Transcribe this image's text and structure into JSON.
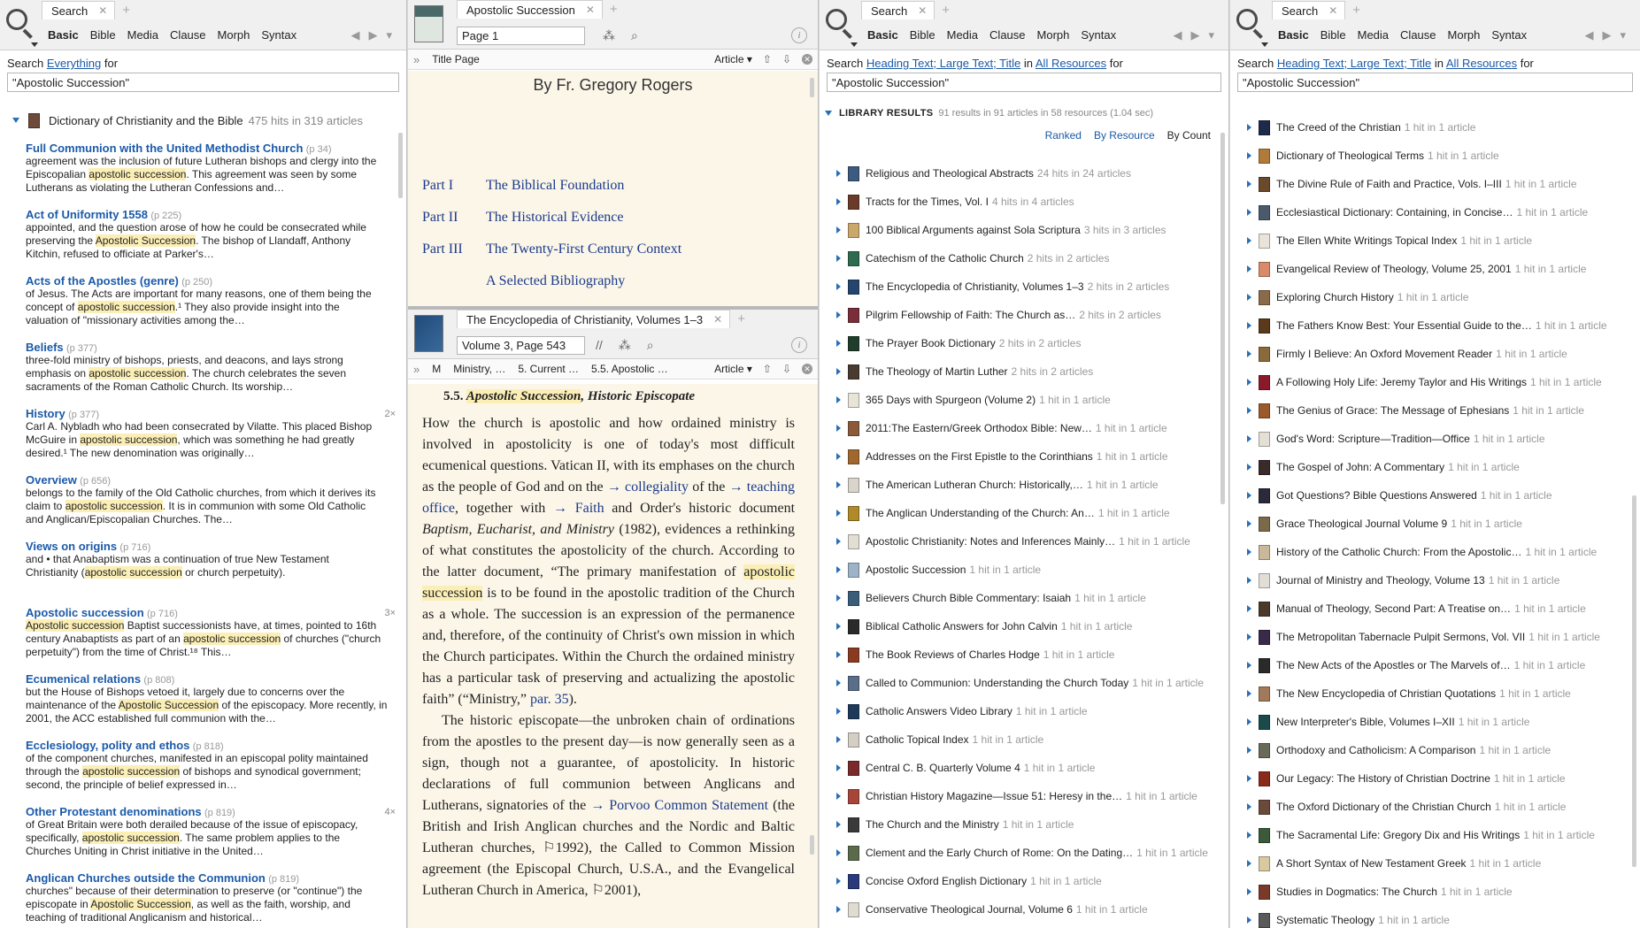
{
  "p1": {
    "tab": "Search",
    "types": [
      "Basic",
      "Bible",
      "Media",
      "Clause",
      "Morph",
      "Syntax"
    ],
    "searchfor": {
      "pre": "Search",
      "scope": "Everything",
      "post": "for"
    },
    "query": "\"Apostolic Succession\"",
    "group": {
      "title": "Dictionary of Christianity and the Bible",
      "hits": "475 hits in 319 articles"
    },
    "results": [
      {
        "title": "Full Communion with the United Methodist Church",
        "page": "(p 34)",
        "count": "",
        "text": [
          "agreement was the inclusion of future Lutheran bishops and clergy into the",
          "Episcopalian |apostolic succession|. This agreement was seen by some",
          "Lutherans as violating the Lutheran Confessions and…"
        ]
      },
      {
        "title": "Act of Uniformity 1558",
        "page": "(p 225)",
        "count": "",
        "text": [
          "appointed, and the question arose of how he could be consecrated while",
          "preserving the |Apostolic Succession|. The bishop of Llandaff, Anthony",
          "Kitchin, refused to officiate at Parker's…"
        ]
      },
      {
        "title": "Acts of the Apostles (genre)",
        "page": "(p 250)",
        "count": "",
        "text": [
          "of Jesus. The Acts are important for many reasons, one of them being the",
          "concept of |apostolic succession|.¹ They also provide insight into the",
          "valuation of \"missionary activities among the…"
        ]
      },
      {
        "title": "Beliefs",
        "page": "(p 377)",
        "count": "",
        "text": [
          "three-fold ministry of bishops, priests, and deacons, and lays strong",
          "emphasis on |apostolic succession|. The church celebrates the seven",
          "sacraments of the Roman Catholic Church. Its worship…"
        ]
      },
      {
        "title": "History",
        "page": "(p 377)",
        "count": "2×",
        "text": [
          "Carl A. Nybladh who had been consecrated by Vilatte. This placed Bishop",
          "McGuire in |apostolic succession|, which was something he had greatly",
          "desired.¹ The new denomination was originally…"
        ]
      },
      {
        "title": "Overview",
        "page": "(p 656)",
        "count": "",
        "text": [
          "belongs to the family of the Old Catholic churches, from which it derives its",
          "claim to |apostolic succession|. It is in communion with some Old Catholic",
          "and Anglican/Episcopalian Churches. The…"
        ]
      },
      {
        "title": "Views on origins",
        "page": "(p 716)",
        "count": "",
        "text": [
          "and • that Anabaptism was a continuation of true New Testament",
          "Christianity (|apostolic succession| or church perpetuity).",
          ""
        ]
      },
      {
        "title": "Apostolic succession",
        "page": "(p 716)",
        "count": "3×",
        "text": [
          "|Apostolic succession| Baptist successionists have, at times, pointed to 16th",
          "century Anabaptists as part of an |apostolic succession| of churches (\"church",
          "perpetuity\") from the time of Christ.¹⁸ This…"
        ]
      },
      {
        "title": "Ecumenical relations",
        "page": "(p 808)",
        "count": "",
        "text": [
          "but the House of Bishops vetoed it, largely due to concerns over the",
          "maintenance of the |Apostolic Succession| of the episcopacy. More recently, in",
          "2001, the ACC established full communion with the…"
        ]
      },
      {
        "title": "Ecclesiology, polity and ethos",
        "page": "(p 818)",
        "count": "",
        "text": [
          "of the component churches, manifested in an episcopal polity maintained",
          "through the |apostolic succession| of bishops and synodical government;",
          "second, the principle of belief expressed in…"
        ]
      },
      {
        "title": "Other Protestant denominations",
        "page": "(p 819)",
        "count": "4×",
        "text": [
          "of Great Britain were both derailed because of the issue of episcopacy,",
          "specifically, |apostolic succession|. The same problem applies to the",
          "Churches Uniting in Christ initiative in the United…"
        ]
      },
      {
        "title": "Anglican Churches outside the Communion",
        "page": "(p 819)",
        "count": "",
        "text": [
          "churches\" because of their determination to preserve (or \"continue\") the",
          "episcopate in |Apostolic Succession|, as well as the faith, worship, and",
          "teaching of traditional Anglicanism and historical…"
        ]
      }
    ]
  },
  "p2": {
    "tab": "Apostolic Succession",
    "page": "Page 1",
    "bar": "Title Page",
    "article": "Article",
    "author": "By Fr. Gregory Rogers",
    "toc": [
      {
        "part": "Part I",
        "title": "The Biblical Foundation"
      },
      {
        "part": "Part II",
        "title": "The Historical Evidence"
      },
      {
        "part": "Part III",
        "title": "The Twenty-First Century Context"
      },
      {
        "part": "",
        "title": "A Selected Bibliography"
      }
    ]
  },
  "p2b": {
    "tab": "The Encyclopedia of Christianity, Volumes 1–3",
    "page": "Volume 3, Page 543",
    "crumbs": [
      "M",
      "Ministry, …",
      "5. Current …",
      "5.5. Apostolic …"
    ],
    "article": "Article",
    "heading_num": "5.5.",
    "heading_hl": "Apostolic Succession",
    "heading_rest": ", Historic Episcopate",
    "para1": [
      {
        "t": "How the church is apostolic and how ordained ministry is involved in apostolicity is one of today's most difficult ecumenical questions. Vatican II, with its emphases on the church as the people of God and on the "
      },
      {
        "t": "→ collegiality",
        "ref": true
      },
      {
        "t": " of the "
      },
      {
        "t": "→ teaching office",
        "ref": true
      },
      {
        "t": ", together with "
      },
      {
        "t": "→ Faith",
        "ref": true
      },
      {
        "t": " and Order's historic document "
      },
      {
        "t": "Baptism, Eucharist, and Ministry",
        "i": true
      },
      {
        "t": " (1982), evidences a rethinking of what constitutes the apostolicity of the church. According to the latter document, “The primary manifestation of "
      },
      {
        "t": "apostolic succession",
        "hl": true
      },
      {
        "t": " is to be found in the apostolic tradition of the Church as a whole. The succession is an expression of the permanence and, therefore, of the continuity of Christ's own mission in which the Church participates. Within the Church the ordained ministry has a particular task of preserving and actualizing the apostolic faith” (“Ministry,” "
      },
      {
        "t": "par. 35",
        "ref": true
      },
      {
        "t": ")."
      }
    ],
    "para2": [
      {
        "t": "The historic episcopate—the unbroken chain of ordinations from the apostles to the present day—is now generally seen as a sign, though not a guarantee, of apostolicity. In historic declarations of full communion between Anglicans and Lutherans, signatories of the "
      },
      {
        "t": "→ Porvoo Common Statement",
        "ref": true
      },
      {
        "t": " (the British and Irish Anglican churches and the Nordic and Baltic Lutheran churches, ⚐1992), the Called to Common Mission agreement (the Episcopal Church, U.S.A., and the Evangelical Lutheran Church in America, ⚐2001),"
      }
    ]
  },
  "p3": {
    "tab": "Search",
    "types": [
      "Basic",
      "Bible",
      "Media",
      "Clause",
      "Morph",
      "Syntax"
    ],
    "searchfor": {
      "pre": "Search",
      "scope": "Heading Text; Large Text; Title",
      "mid": "in",
      "res": "All Resources",
      "post": "for"
    },
    "query": "\"Apostolic Succession\"",
    "lib": {
      "label": "LIBRARY RESULTS",
      "summary": "91 results in 91 articles in 58 resources (1.04 sec)"
    },
    "sort": [
      "Ranked",
      "By Resource",
      "By Count"
    ],
    "items": [
      {
        "t": "Religious and Theological Abstracts",
        "c": "24 hits in 24 articles",
        "col": "#3d5a80"
      },
      {
        "t": "Tracts for the Times, Vol. I",
        "c": "4 hits in 4 articles",
        "col": "#6b3b2a"
      },
      {
        "t": "100 Biblical Arguments against Sola Scriptura",
        "c": "3 hits in 3 articles",
        "col": "#c9a86a"
      },
      {
        "t": "Catechism of the Catholic Church",
        "c": "2 hits in 2 articles",
        "col": "#2e6b4f"
      },
      {
        "t": "The Encyclopedia of Christianity, Volumes 1–3",
        "c": "2 hits in 2 articles",
        "col": "#24466e"
      },
      {
        "t": "Pilgrim Fellowship of Faith: The Church as…",
        "c": "2 hits in 2 articles",
        "col": "#7a2e3a"
      },
      {
        "t": "The Prayer Book Dictionary",
        "c": "2 hits in 2 articles",
        "col": "#1f3d2a"
      },
      {
        "t": "The Theology of Martin Luther",
        "c": "2 hits in 2 articles",
        "col": "#4a3b30"
      },
      {
        "t": "365 Days with Spurgeon (Volume 2)",
        "c": "1 hit in 1 article",
        "col": "#e9e4d8"
      },
      {
        "t": "2011:The Eastern/Greek Orthodox Bible: New…",
        "c": "1 hit in 1 article",
        "col": "#8a5a3a"
      },
      {
        "t": "Addresses on the First Epistle to the Corinthians",
        "c": "1 hit in 1 article",
        "col": "#a0672f"
      },
      {
        "t": "The American Lutheran Church: Historically,…",
        "c": "1 hit in 1 article",
        "col": "#d9d5cc"
      },
      {
        "t": "The Anglican Understanding of the Church: An…",
        "c": "1 hit in 1 article",
        "col": "#b08a2a"
      },
      {
        "t": "Apostolic Christianity: Notes and Inferences Mainly…",
        "c": "1 hit in 1 article",
        "col": "#e2ded4"
      },
      {
        "t": "Apostolic Succession",
        "c": "1 hit in 1 article",
        "col": "#9fb3c8"
      },
      {
        "t": "Believers Church Bible Commentary: Isaiah",
        "c": "1 hit in 1 article",
        "col": "#3a5e7a"
      },
      {
        "t": "Biblical Catholic Answers for John Calvin",
        "c": "1 hit in 1 article",
        "col": "#2a2a2a"
      },
      {
        "t": "The Book Reviews of Charles Hodge",
        "c": "1 hit in 1 article",
        "col": "#8a3a20"
      },
      {
        "t": "Called to Communion: Understanding the Church Today",
        "c": "1 hit in 1 article",
        "col": "#5a6e8a"
      },
      {
        "t": "Catholic Answers Video Library",
        "c": "1 hit in 1 article",
        "col": "#1d3a5a"
      },
      {
        "t": "Catholic Topical Index",
        "c": "1 hit in 1 article",
        "col": "#d4cfc4"
      },
      {
        "t": "Central C. B. Quarterly Volume 4",
        "c": "1 hit in 1 article",
        "col": "#7a2a2a"
      },
      {
        "t": "Christian History Magazine—Issue 51: Heresy in the…",
        "c": "1 hit in 1 article",
        "col": "#a8453a"
      },
      {
        "t": "The Church and the Ministry",
        "c": "1 hit in 1 article",
        "col": "#3a3a3a"
      },
      {
        "t": "Clement and the Early Church of Rome: On the Dating…",
        "c": "1 hit in 1 article",
        "col": "#5a6a4a"
      },
      {
        "t": "Concise Oxford English Dictionary",
        "c": "1 hit in 1 article",
        "col": "#2a3a7a"
      },
      {
        "t": "Conservative Theological Journal, Volume 6",
        "c": "1 hit in 1 article",
        "col": "#e0dcd2"
      }
    ]
  },
  "p4": {
    "tab": "Search",
    "types": [
      "Basic",
      "Bible",
      "Media",
      "Clause",
      "Morph",
      "Syntax"
    ],
    "searchfor": {
      "pre": "Search",
      "scope": "Heading Text; Large Text; Title",
      "mid": "in",
      "res": "All Resources",
      "post": "for"
    },
    "query": "\"Apostolic Succession\"",
    "items": [
      {
        "t": "The Creed of the Christian",
        "c": "1 hit in 1 article",
        "col": "#1d2a4a"
      },
      {
        "t": "Dictionary of Theological Terms",
        "c": "1 hit in 1 article",
        "col": "#b07a3a"
      },
      {
        "t": "The Divine Rule of Faith and Practice, Vols. I–III",
        "c": "1 hit in 1 article",
        "col": "#6a4a2a"
      },
      {
        "t": "Ecclesiastical Dictionary: Containing, in Concise…",
        "c": "1 hit in 1 article",
        "col": "#4a5a6a"
      },
      {
        "t": "The Ellen White Writings Topical Index",
        "c": "1 hit in 1 article",
        "col": "#e8e4da"
      },
      {
        "t": "Evangelical Review of Theology, Volume 25, 2001",
        "c": "1 hit in 1 article",
        "col": "#d98a6a"
      },
      {
        "t": "Exploring Church History",
        "c": "1 hit in 1 article",
        "col": "#8a6a4a"
      },
      {
        "t": "The Fathers Know Best: Your Essential Guide to the…",
        "c": "1 hit in 1 article",
        "col": "#5a3a1a"
      },
      {
        "t": "Firmly I Believe: An Oxford Movement Reader",
        "c": "1 hit in 1 article",
        "col": "#8a6a3a"
      },
      {
        "t": "A Following Holy Life: Jeremy Taylor and His Writings",
        "c": "1 hit in 1 article",
        "col": "#8a1a2a"
      },
      {
        "t": "The Genius of Grace: The Message of Ephesians",
        "c": "1 hit in 1 article",
        "col": "#9a5a2a"
      },
      {
        "t": "God's Word: Scripture—Tradition—Office",
        "c": "1 hit in 1 article",
        "col": "#e4e0d6"
      },
      {
        "t": "The Gospel of John: A Commentary",
        "c": "1 hit in 1 article",
        "col": "#3a2a2a"
      },
      {
        "t": "Got Questions? Bible Questions Answered",
        "c": "1 hit in 1 article",
        "col": "#2a2a3a"
      },
      {
        "t": "Grace Theological Journal Volume 9",
        "c": "1 hit in 1 article",
        "col": "#7a6a4a"
      },
      {
        "t": "History of the Catholic Church: From the Apostolic…",
        "c": "1 hit in 1 article",
        "col": "#c9b89a"
      },
      {
        "t": "Journal of Ministry and Theology, Volume 13",
        "c": "1 hit in 1 article",
        "col": "#e2ded6"
      },
      {
        "t": "Manual of Theology, Second Part: A Treatise on…",
        "c": "1 hit in 1 article",
        "col": "#4a3a2a"
      },
      {
        "t": "The Metropolitan Tabernacle Pulpit Sermons, Vol. VII",
        "c": "1 hit in 1 article",
        "col": "#3a2a4a"
      },
      {
        "t": "The New Acts of the Apostles or The Marvels of…",
        "c": "1 hit in 1 article",
        "col": "#2a2a2a"
      },
      {
        "t": "The New Encyclopedia of Christian Quotations",
        "c": "1 hit in 1 article",
        "col": "#a07a5a"
      },
      {
        "t": "New Interpreter's Bible, Volumes I–XII",
        "c": "1 hit in 1 article",
        "col": "#1a4a4a"
      },
      {
        "t": "Orthodoxy and Catholicism: A Comparison",
        "c": "1 hit in 1 article",
        "col": "#6a6a5a"
      },
      {
        "t": "Our Legacy: The History of Christian Doctrine",
        "c": "1 hit in 1 article",
        "col": "#8a2a1a"
      },
      {
        "t": "The Oxford Dictionary of the Christian Church",
        "c": "1 hit in 1 article",
        "col": "#6a4a3a"
      },
      {
        "t": "The Sacramental Life: Gregory Dix and His Writings",
        "c": "1 hit in 1 article",
        "col": "#3a5a3a"
      },
      {
        "t": "A Short Syntax of New Testament Greek",
        "c": "1 hit in 1 article",
        "col": "#d9c9a0"
      },
      {
        "t": "Studies in Dogmatics: The Church",
        "c": "1 hit in 1 article",
        "col": "#7a3a2a"
      },
      {
        "t": "Systematic Theology",
        "c": "1 hit in 1 article",
        "col": "#5a5a5a"
      }
    ]
  }
}
